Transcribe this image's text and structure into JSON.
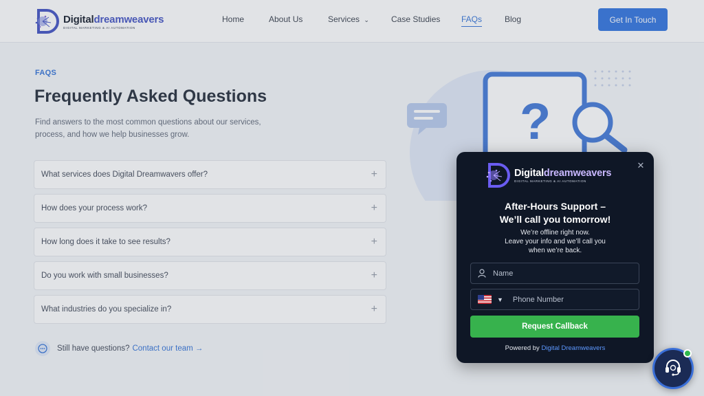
{
  "brand": {
    "name_part1": "Digital",
    "name_part2": "dreamweavers",
    "tagline": "DIGITAL MARKETING & AI AUTOMATION"
  },
  "nav": {
    "items": [
      {
        "label": "Home"
      },
      {
        "label": "About Us"
      },
      {
        "label": "Services"
      },
      {
        "label": "Case Studies"
      },
      {
        "label": "FAQs",
        "active": true
      },
      {
        "label": "Blog"
      }
    ],
    "cta_label": "Get In Touch"
  },
  "hero": {
    "eyebrow": "FAQS",
    "title": "Frequently Asked Questions",
    "subtitle": "Find answers to the most common questions about our services, process, and how we help businesses grow."
  },
  "faqs": [
    {
      "question": "What services does Digital Dreamwavers offer?"
    },
    {
      "question": "How does your process work?"
    },
    {
      "question": "How long does it take to see results?"
    },
    {
      "question": "Do you work with small businesses?"
    },
    {
      "question": "What industries do you specialize in?"
    }
  ],
  "contact_prompt": {
    "text": "Still have questions?",
    "link": "Contact our team →"
  },
  "widget": {
    "title_line1": "After-Hours Support –",
    "title_line2": "We’ll call you tomorrow!",
    "desc_line1": "We’re offline right now.",
    "desc_line2": "Leave your info and we’ll call you",
    "desc_line3": "when we’re back.",
    "name_placeholder": "Name",
    "phone_placeholder": "Phone Number",
    "country_flag": "US",
    "submit_label": "Request Callback",
    "powered_prefix": "Powered by",
    "powered_brand": "Digital Dreamweavers"
  },
  "colors": {
    "primary": "#2a6fde",
    "success": "#37b24d",
    "widget_bg": "#0f1726",
    "online": "#2fb84e"
  }
}
